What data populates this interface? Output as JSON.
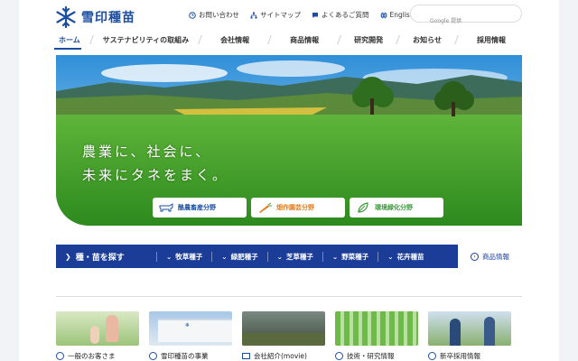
{
  "header": {
    "logo_text": "雪印種苗",
    "util": [
      {
        "icon": "clock-icon",
        "label": "お問い合わせ"
      },
      {
        "icon": "sitemap-icon",
        "label": "サイトマップ"
      },
      {
        "icon": "chat-icon",
        "label": "よくあるご質問"
      },
      {
        "icon": "globe-icon",
        "label": "English"
      }
    ],
    "search_brand": "Google 提供"
  },
  "nav": [
    "ホーム",
    "サステナビリティの取組み",
    "会社情報",
    "商品情報",
    "研究開発",
    "お知らせ",
    "採用情報"
  ],
  "hero": {
    "line1": "農業に、社会に、",
    "line2": "未来にタネをまく。",
    "categories": [
      {
        "icon": "cow-icon",
        "label": "酪農畜産分野",
        "color": "#1c4ea0"
      },
      {
        "icon": "carrot-icon",
        "label": "畑作園芸分野",
        "color": "#e07a1a"
      },
      {
        "icon": "leaf-icon",
        "label": "環境緑化分野",
        "color": "#3a9a3a"
      }
    ]
  },
  "seeds": {
    "title": "種・苗を探す",
    "items": [
      "牧草種子",
      "緑肥種子",
      "芝草種子",
      "野菜種子",
      "花卉種苗"
    ],
    "link": "商品情報"
  },
  "thumbs": [
    "一般のお客さま",
    "雪印種苗の事業",
    "会社紹介(movie)",
    "技術・研究情報",
    "新卒採用情報"
  ],
  "colors": {
    "brand": "#1c4ea0",
    "bar": "#1c3d97"
  }
}
